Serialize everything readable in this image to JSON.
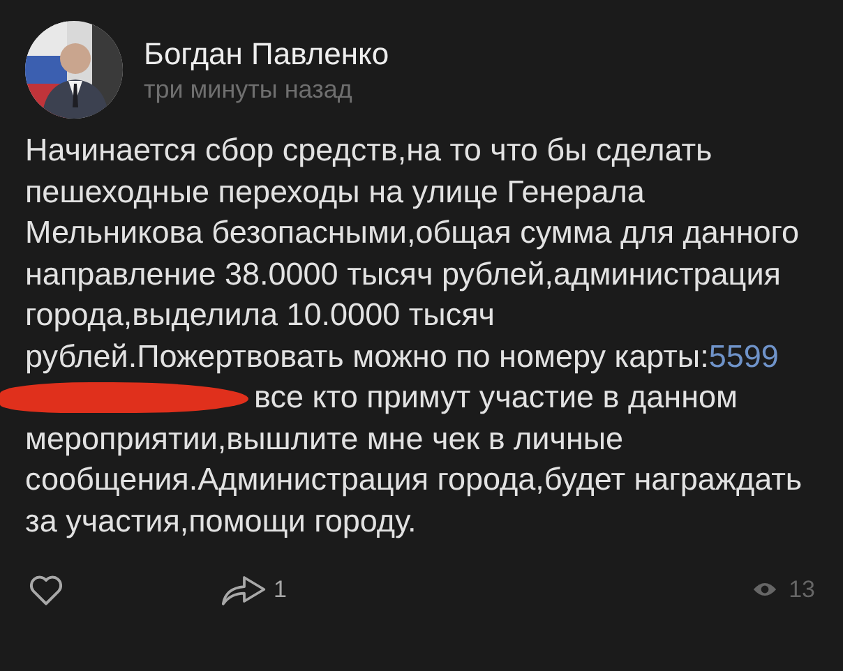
{
  "post": {
    "author": "Богдан Павленко",
    "time": "три минуты назад",
    "lines": [
      {
        "text": "Начинается сбор средств,на то что бы сделать"
      },
      {
        "text": "пешеходные переходы на улице Генерала"
      },
      {
        "text": "Мельникова безопасными,общая сумма для данного"
      },
      {
        "text": "направление 38.0000 тысяч рублей,администрация"
      },
      {
        "text": "города,выделила 10.0000 тысяч"
      },
      {
        "text": "рублей.Пожертвовать можно по номеру карты:",
        "link": "5599"
      },
      {
        "text": "все кто примут участие в данном",
        "redacted": true
      },
      {
        "text": "мероприятии,вышлите мне чек в личные"
      },
      {
        "text": "сообщения.Администрация города,будет награждать"
      },
      {
        "text": "за участия,помощи городу."
      }
    ]
  },
  "actions": {
    "liked": false,
    "reposts": "1",
    "views": "13"
  }
}
